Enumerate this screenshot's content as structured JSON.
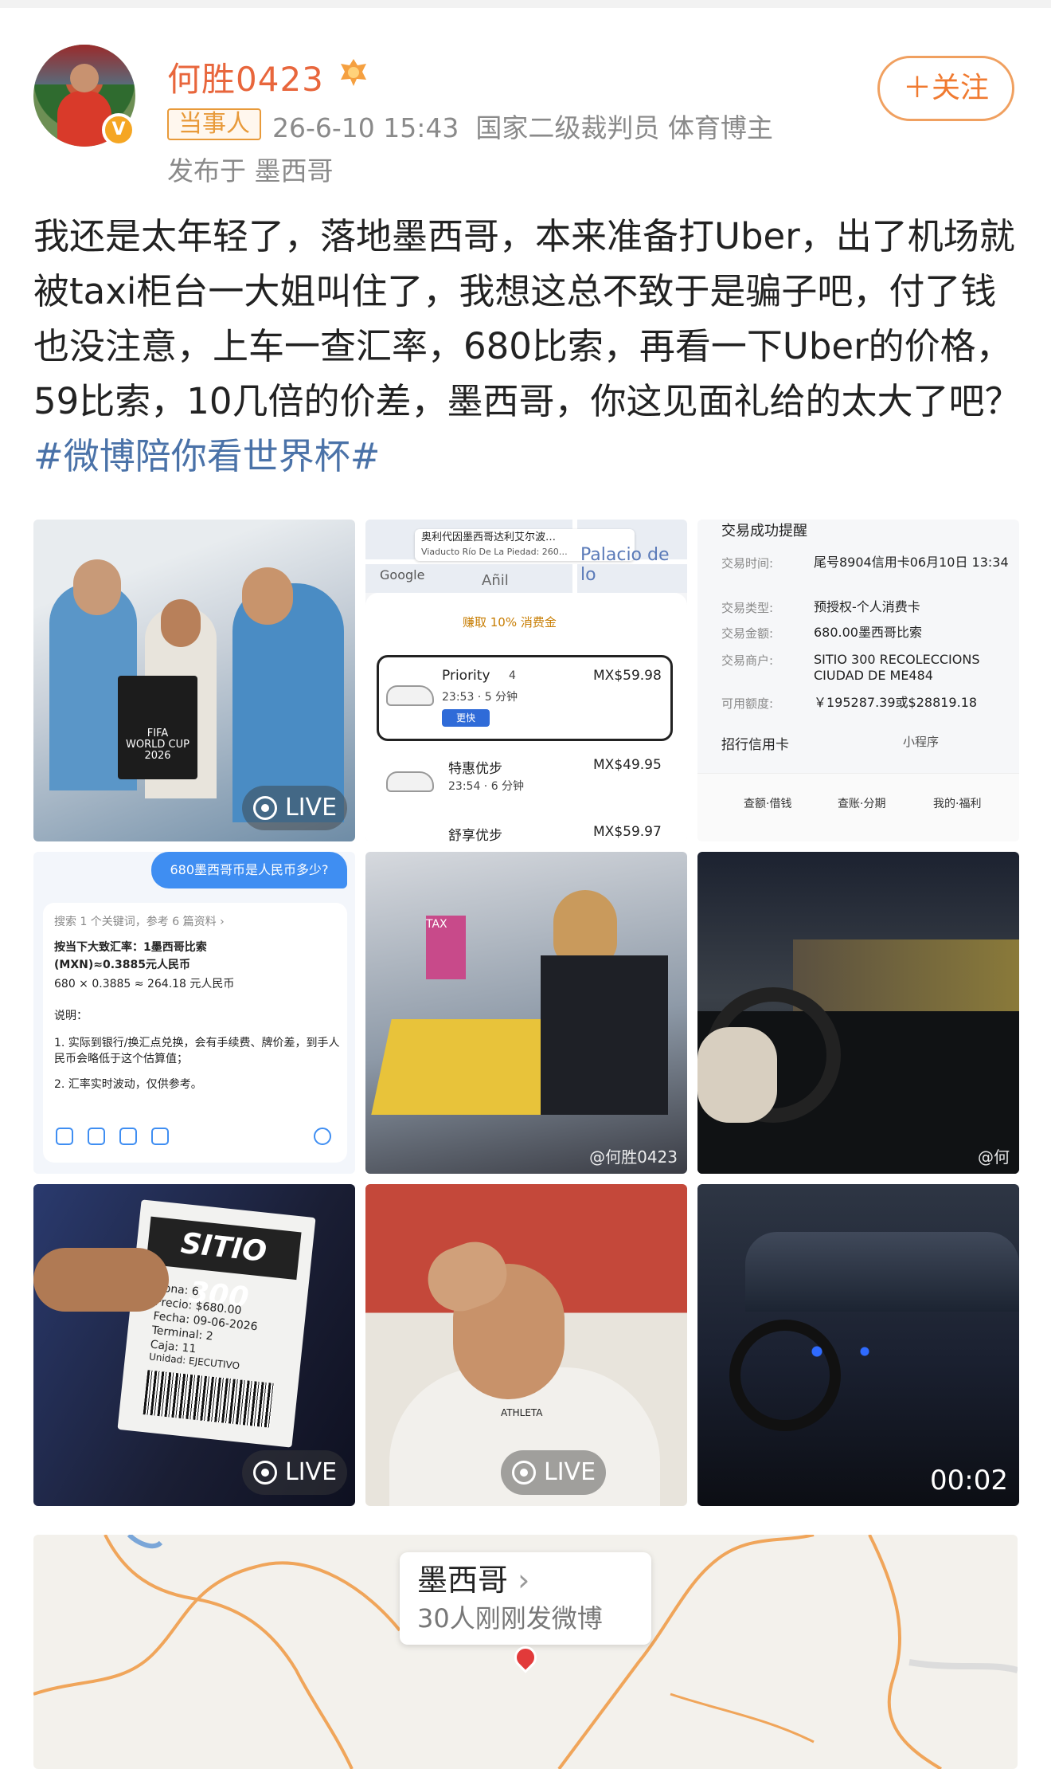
{
  "user": {
    "name": "何胜0423",
    "role_badge": "当事人",
    "timestamp": "26-6-10 15:43",
    "title": "国家二级裁判员 体育博主",
    "location": "发布于 墨西哥",
    "verified_mark": "V"
  },
  "follow_button": "＋关注",
  "post": {
    "text": "我还是太年轻了，落地墨西哥，本来准备打Uber，出了机场就被taxi柜台一大姐叫住了，我想这总不致于是骗子吧，付了钱也没注意，上车一查汇率，680比索，再看一下Uber的价格，59比索，10几倍的价差，墨西哥，你这见面礼给的太大了吧？",
    "hashtag": "#微博陪你看世界杯#"
  },
  "images": {
    "live_label": "LIVE",
    "video_duration": "00:02",
    "watermark": "@何胜0423",
    "watermark_short": "@何",
    "uber": {
      "map_title": "奥利代因墨西哥达利艾尔波…",
      "map_subtitle": "Viaducto Río De La Piedad: 260…",
      "google": "Google",
      "palace": "Palacio de lo",
      "anil": "Añil",
      "earn": "赚取 10% 消费金",
      "opt1_name": "Priority",
      "opt1_seats": "4",
      "opt1_time": "23:53 · 5 分钟",
      "opt1_price": "MX$59.98",
      "opt1_tag": "更快",
      "opt2_name": "特惠优步",
      "opt2_time": "23:54 · 6 分钟",
      "opt2_price": "MX$49.95",
      "opt3_name": "舒享优步",
      "opt3_price": "MX$59.97"
    },
    "receipt": {
      "title": "交易成功提醒",
      "rows": [
        {
          "label": "交易时间:",
          "value": "尾号8904信用卡06月10日 13:34"
        },
        {
          "label": "交易类型:",
          "value": "预授权-个人消费卡"
        },
        {
          "label": "交易金额:",
          "value": "680.00墨西哥比索"
        },
        {
          "label": "交易商户:",
          "value": "SITIO 300 RECOLECCIONS CIUDAD DE ME484"
        },
        {
          "label": "可用额度:",
          "value": "￥195287.39或$28819.18"
        }
      ],
      "card_link": "招行信用卡",
      "mini_program": "小程序",
      "tabs": [
        "查额·借钱",
        "查账·分期",
        "我的·福利"
      ]
    },
    "chat": {
      "question": "680墨西哥币是人民币多少?",
      "search_note": "搜索 1 个关键词，参考 6 篇资料 ›",
      "rate_line1": "按当下大致汇率：1墨西哥比索",
      "rate_line2": "(MXN)≈0.3885元人民币",
      "calc": "680 × 0.3885 ≈ 264.18 元人民币",
      "note_title": "说明：",
      "note1": "1. 实际到银行/换汇点兑换，会有手续费、牌价差，到手人民币会略低于这个估算值；",
      "note2": "2. 汇率实时波动，仅供参考。"
    },
    "ticket": {
      "brand": "SITIO 300",
      "zona": "Zona: 6",
      "precio": "Precio: $680.00",
      "fecha": "Fecha: 09-06-2026",
      "terminal": "Terminal: 2",
      "caja": "Caja: 11",
      "unidad": "Unidad: EJECUTIVO"
    },
    "poster": {
      "fifa": "FIFA",
      "cup": "WORLD CUP",
      "year": "2026"
    },
    "shirt_brand": "ATHLETA",
    "counter_sign": "TAX"
  },
  "map_card": {
    "city": "墨西哥",
    "count": "30人刚刚发微博"
  },
  "colors": {
    "username": "#e8663c",
    "hashtag": "#4a72a8",
    "follow_border": "#f0a060",
    "accent_blue": "#3f8ef2"
  }
}
